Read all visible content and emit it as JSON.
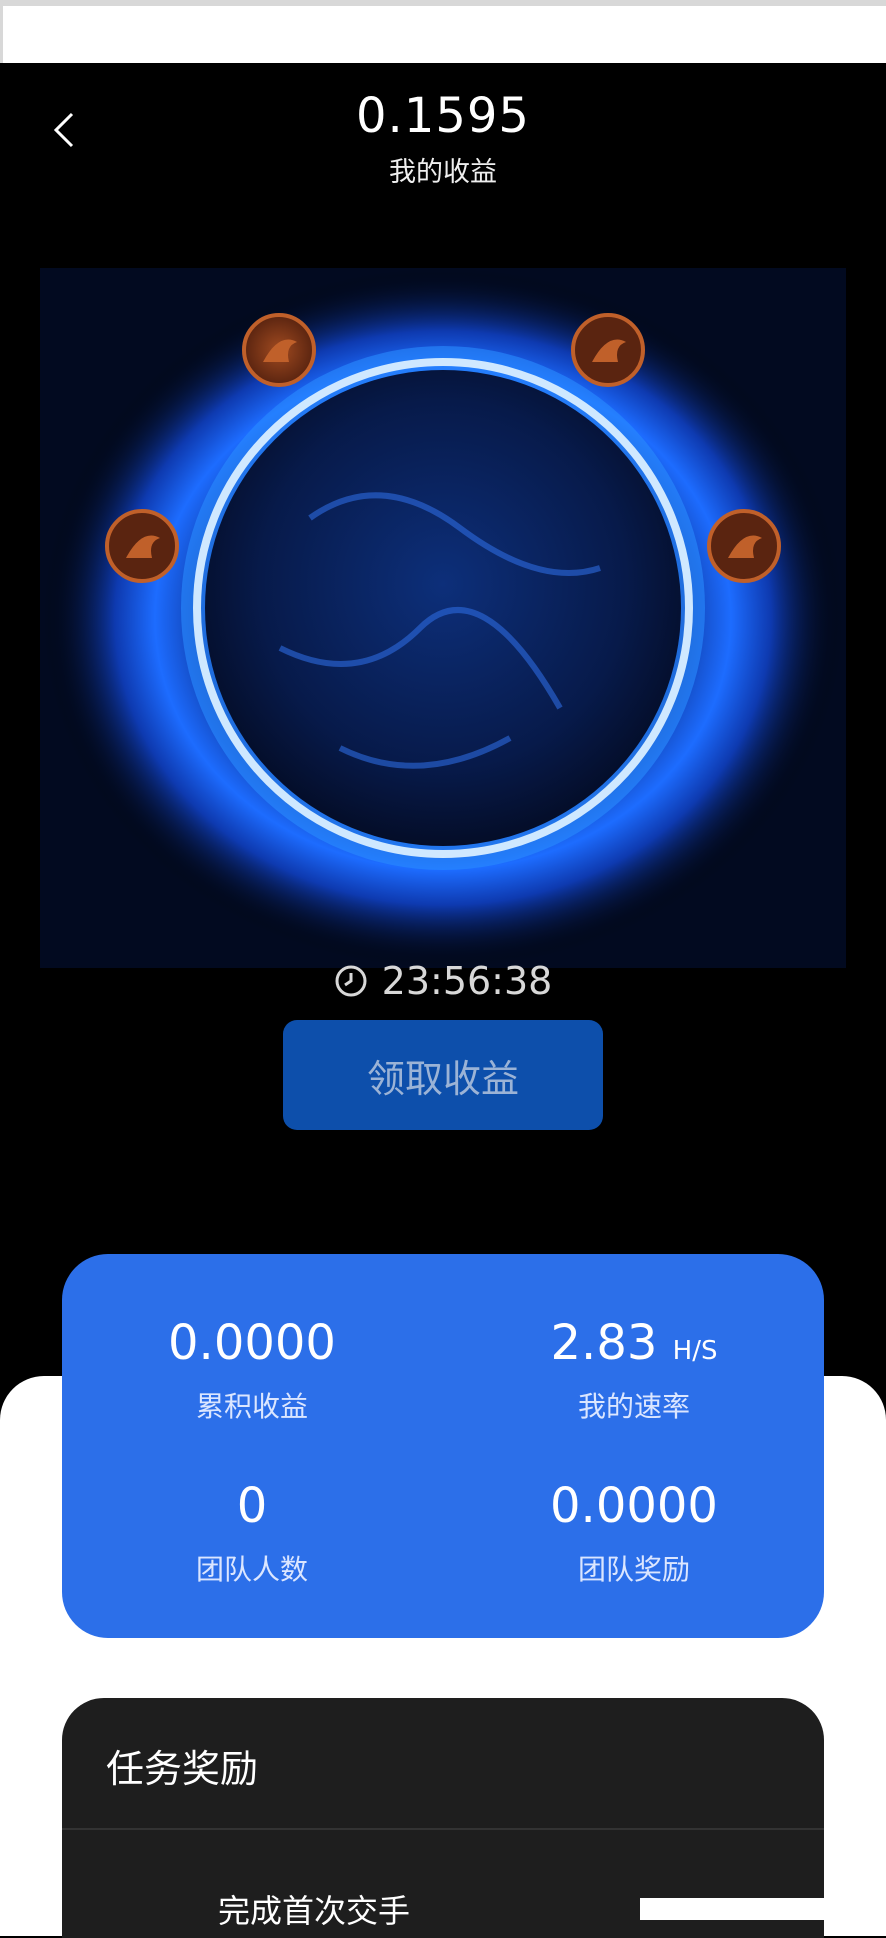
{
  "header": {
    "earnings_value": "0.1595",
    "earnings_label": "我的收益"
  },
  "timer": {
    "icon": "clock-icon",
    "countdown": "23:56:38"
  },
  "claim_button": {
    "label": "领取收益"
  },
  "stats": {
    "cumulative": {
      "value": "0.0000",
      "label": "累积收益"
    },
    "rate": {
      "value": "2.83",
      "unit": "H/S",
      "label": "我的速率"
    },
    "team_size": {
      "value": "0",
      "label": "团队人数"
    },
    "team_reward": {
      "value": "0.0000",
      "label": "团队奖励"
    }
  },
  "tasks": {
    "title": "任务奖励",
    "first_item": "完成首次交手"
  },
  "colors": {
    "background": "#000000",
    "stats_card": "#2c6fe9",
    "claim_button": "#0d4fab",
    "coin": "#c0602a"
  }
}
